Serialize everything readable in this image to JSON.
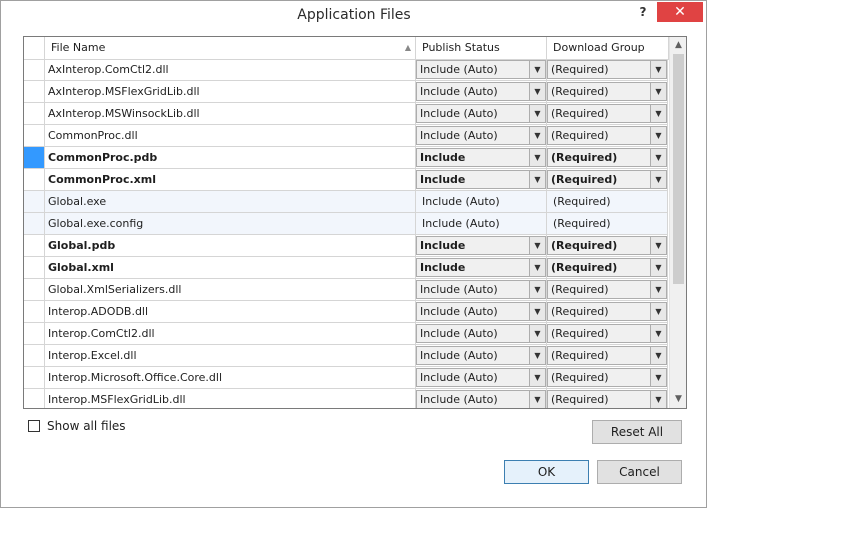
{
  "window": {
    "title": "Application Files",
    "help_label": "?",
    "close_label": "✕"
  },
  "grid": {
    "columns": {
      "name": "File Name",
      "publish": "Publish Status",
      "group": "Download Group"
    },
    "sort_indicator": "▲",
    "rows": [
      {
        "name": "AxInterop.ComCtl2.dll",
        "publish": "Include (Auto)",
        "group": "(Required)",
        "style": "combo"
      },
      {
        "name": "AxInterop.MSFlexGridLib.dll",
        "publish": "Include (Auto)",
        "group": "(Required)",
        "style": "combo"
      },
      {
        "name": "AxInterop.MSWinsockLib.dll",
        "publish": "Include (Auto)",
        "group": "(Required)",
        "style": "combo"
      },
      {
        "name": "CommonProc.dll",
        "publish": "Include (Auto)",
        "group": "(Required)",
        "style": "combo"
      },
      {
        "name": "CommonProc.pdb",
        "publish": "Include",
        "group": "(Required)",
        "style": "combo-bold-selected"
      },
      {
        "name": "CommonProc.xml",
        "publish": "Include",
        "group": "(Required)",
        "style": "combo-bold"
      },
      {
        "name": "Global.exe",
        "publish": "Include (Auto)",
        "group": "(Required)",
        "style": "plain"
      },
      {
        "name": "Global.exe.config",
        "publish": "Include (Auto)",
        "group": "(Required)",
        "style": "plain"
      },
      {
        "name": "Global.pdb",
        "publish": "Include",
        "group": "(Required)",
        "style": "combo-bold"
      },
      {
        "name": "Global.xml",
        "publish": "Include",
        "group": "(Required)",
        "style": "combo-bold"
      },
      {
        "name": "Global.XmlSerializers.dll",
        "publish": "Include (Auto)",
        "group": "(Required)",
        "style": "combo"
      },
      {
        "name": "Interop.ADODB.dll",
        "publish": "Include (Auto)",
        "group": "(Required)",
        "style": "combo"
      },
      {
        "name": "Interop.ComCtl2.dll",
        "publish": "Include (Auto)",
        "group": "(Required)",
        "style": "combo"
      },
      {
        "name": "Interop.Excel.dll",
        "publish": "Include (Auto)",
        "group": "(Required)",
        "style": "combo"
      },
      {
        "name": "Interop.Microsoft.Office.Core.dll",
        "publish": "Include (Auto)",
        "group": "(Required)",
        "style": "combo"
      },
      {
        "name": "Interop.MSFlexGridLib.dll",
        "publish": "Include (Auto)",
        "group": "(Required)",
        "style": "combo"
      }
    ]
  },
  "footer": {
    "show_all_files_label": "Show all files",
    "show_all_files_checked": false,
    "reset_all_label": "Reset All",
    "ok_label": "OK",
    "cancel_label": "Cancel"
  },
  "colors": {
    "selection": "#3399ff",
    "close_button": "#e04343",
    "row_tint": "#f2f6fc"
  }
}
